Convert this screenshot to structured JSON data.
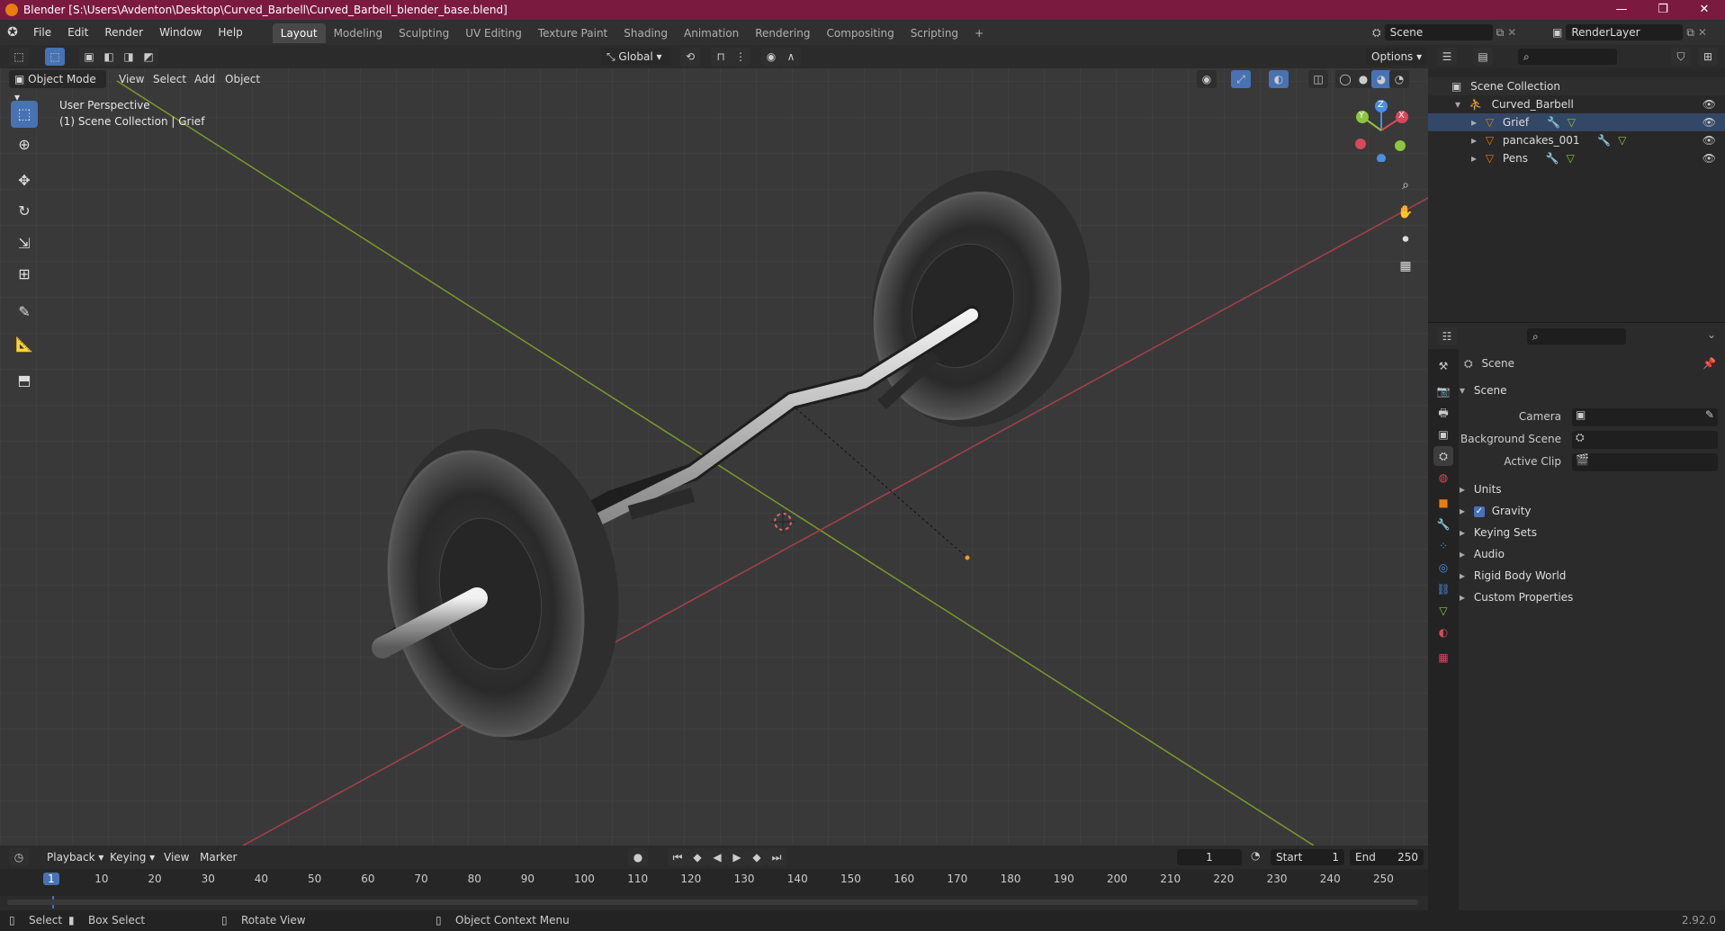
{
  "window": {
    "title": "Blender [S:\\Users\\Avdenton\\Desktop\\Curved_Barbell\\Curved_Barbell_blender_base.blend]",
    "minimize": "—",
    "restore": "❐",
    "close": "✕"
  },
  "menubar": {
    "items": [
      "File",
      "Edit",
      "Render",
      "Window",
      "Help"
    ],
    "workspace_tabs": [
      "Layout",
      "Modeling",
      "Sculpting",
      "UV Editing",
      "Texture Paint",
      "Shading",
      "Animation",
      "Rendering",
      "Compositing",
      "Scripting"
    ],
    "add_tab": "+",
    "scene_name": "Scene",
    "render_layer": "RenderLayer"
  },
  "viewport_header": {
    "transform_orientation": "Global",
    "options_label": "Options",
    "mode": "Object Mode",
    "menus": [
      "View",
      "Select",
      "Add",
      "Object"
    ]
  },
  "viewport": {
    "perspective": "User Perspective",
    "collection_info": "(1) Scene Collection | Grief",
    "gizmo": {
      "x": "X",
      "y": "Y",
      "z": "Z"
    }
  },
  "outliner": {
    "root": "Scene Collection",
    "collection": "Curved_Barbell",
    "objects": [
      "Grief",
      "pancakes_001",
      "Pens"
    ]
  },
  "properties": {
    "context": "Scene",
    "panel_title": "Scene",
    "fields": [
      {
        "label": "Camera"
      },
      {
        "label": "Background Scene"
      },
      {
        "label": "Active Clip"
      }
    ],
    "sections": [
      {
        "label": "Units",
        "checkbox": false
      },
      {
        "label": "Gravity",
        "checkbox": true
      },
      {
        "label": "Keying Sets",
        "checkbox": false
      },
      {
        "label": "Audio",
        "checkbox": false
      },
      {
        "label": "Rigid Body World",
        "checkbox": false
      },
      {
        "label": "Custom Properties",
        "checkbox": false
      }
    ]
  },
  "timeline": {
    "menus": [
      "Playback",
      "Keying",
      "View",
      "Marker"
    ],
    "current_frame": "1",
    "start_label": "Start",
    "start": "1",
    "end_label": "End",
    "end": "250",
    "ticks": [
      "1",
      "10",
      "20",
      "30",
      "40",
      "50",
      "60",
      "70",
      "80",
      "90",
      "100",
      "110",
      "120",
      "130",
      "140",
      "150",
      "160",
      "170",
      "180",
      "190",
      "200",
      "210",
      "220",
      "230",
      "240",
      "250"
    ]
  },
  "statusbar": {
    "select": "Select",
    "box_select": "Box Select",
    "rotate_view": "Rotate View",
    "context_menu": "Object Context Menu",
    "version": "2.92.0"
  },
  "colors": {
    "title_bg": "#7a1a3f",
    "accent": "#4772b3",
    "x_axis": "#d9485a",
    "y_axis": "#8cc63f",
    "z_axis": "#4a8fe0",
    "object_orange": "#e87d0d"
  }
}
